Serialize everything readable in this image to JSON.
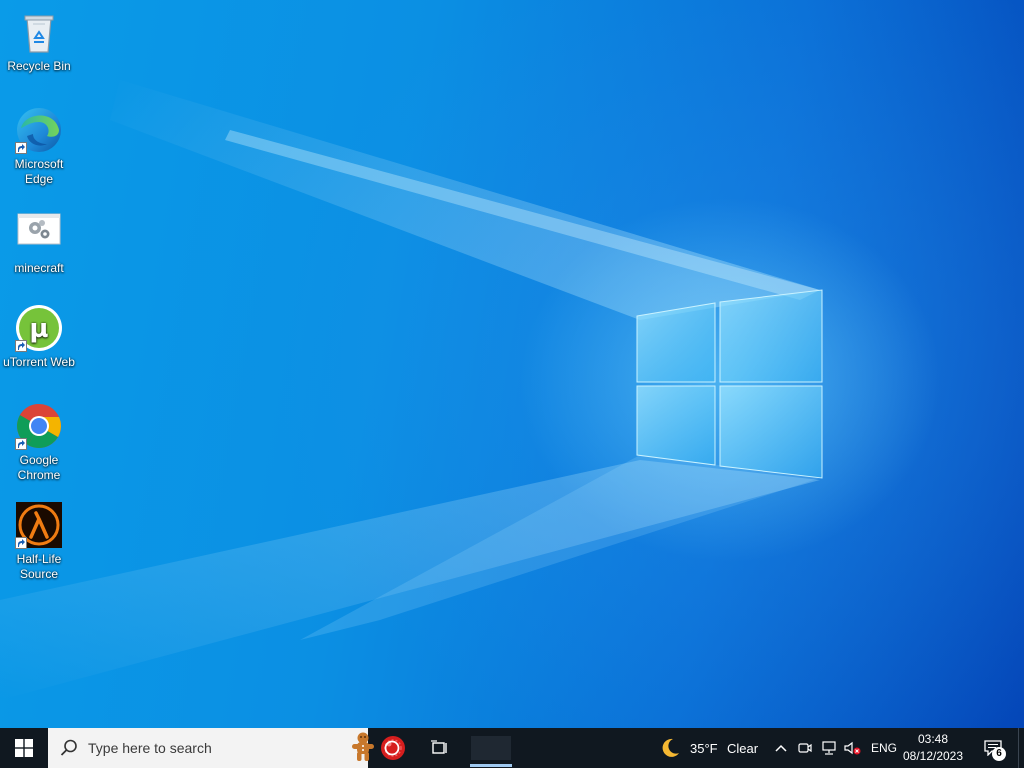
{
  "desktop": {
    "icons": [
      {
        "label": "Recycle Bin",
        "icon": "recycle-bin-icon"
      },
      {
        "label": "Microsoft Edge",
        "icon": "edge-icon"
      },
      {
        "label": "minecraft",
        "icon": "settings-gears-icon"
      },
      {
        "label": "uTorrent Web",
        "icon": "utorrent-icon"
      },
      {
        "label": "Google Chrome",
        "icon": "chrome-icon"
      },
      {
        "label": "Half-Life Source",
        "icon": "half-life-icon"
      }
    ]
  },
  "taskbar": {
    "search_placeholder": "Type here to search",
    "weather": {
      "temperature": "35°F",
      "condition": "Clear"
    },
    "language": "ENG",
    "time": "03:48",
    "date": "08/12/2023",
    "notification_count": "6",
    "colors": {
      "background": "#101820",
      "accent": "#0a78d7"
    }
  }
}
